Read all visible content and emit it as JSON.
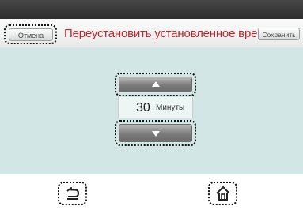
{
  "header": {
    "cancel_label": "Отмена",
    "title": "Переустановить установленное время",
    "save_label": "Сохранить"
  },
  "timer": {
    "value": "30",
    "unit": "Минуты"
  },
  "nav": {
    "back_icon": "back-arrow-icon",
    "home_icon": "home-icon"
  },
  "colors": {
    "title": "#b8272f",
    "content_bg": "#d3e6e6",
    "topbar": "#3a3a3a"
  }
}
